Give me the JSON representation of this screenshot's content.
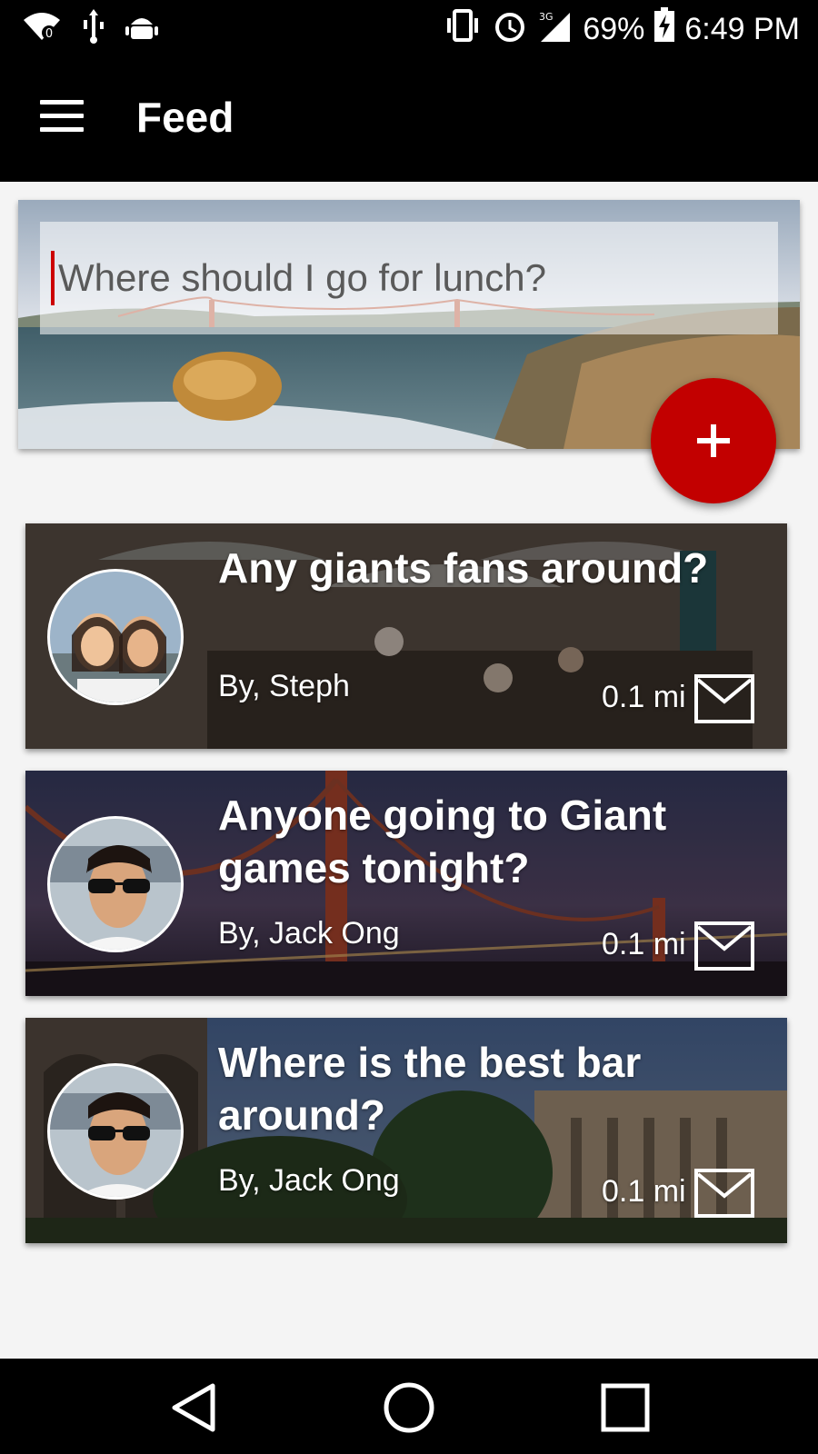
{
  "status_bar": {
    "battery_percent": "69%",
    "time": "6:49 PM",
    "network": "3G",
    "icons": [
      "wifi-icon",
      "usb-icon",
      "android-debug-icon",
      "vibrate-icon",
      "alarm-icon",
      "signal-icon",
      "battery-charging-icon"
    ]
  },
  "app_bar": {
    "title": "Feed",
    "menu_icon": "hamburger-menu-icon"
  },
  "compose": {
    "placeholder": "Where should I go for lunch?",
    "value": ""
  },
  "fab": {
    "icon": "plus-icon",
    "color": "#c20000"
  },
  "posts": [
    {
      "title": "Any giants fans around?",
      "author": "By, Steph",
      "distance": "0.1 mi",
      "action_icon": "mail-icon"
    },
    {
      "title": "Anyone going to Giant games tonight?",
      "author": "By, Jack Ong",
      "distance": "0.1 mi",
      "action_icon": "mail-icon"
    },
    {
      "title": "Where is the best bar around?",
      "author": "By, Jack Ong",
      "distance": "0.1 mi",
      "action_icon": "mail-icon"
    }
  ],
  "nav_bar": {
    "icons": [
      "back-icon",
      "home-icon",
      "recents-icon"
    ]
  }
}
